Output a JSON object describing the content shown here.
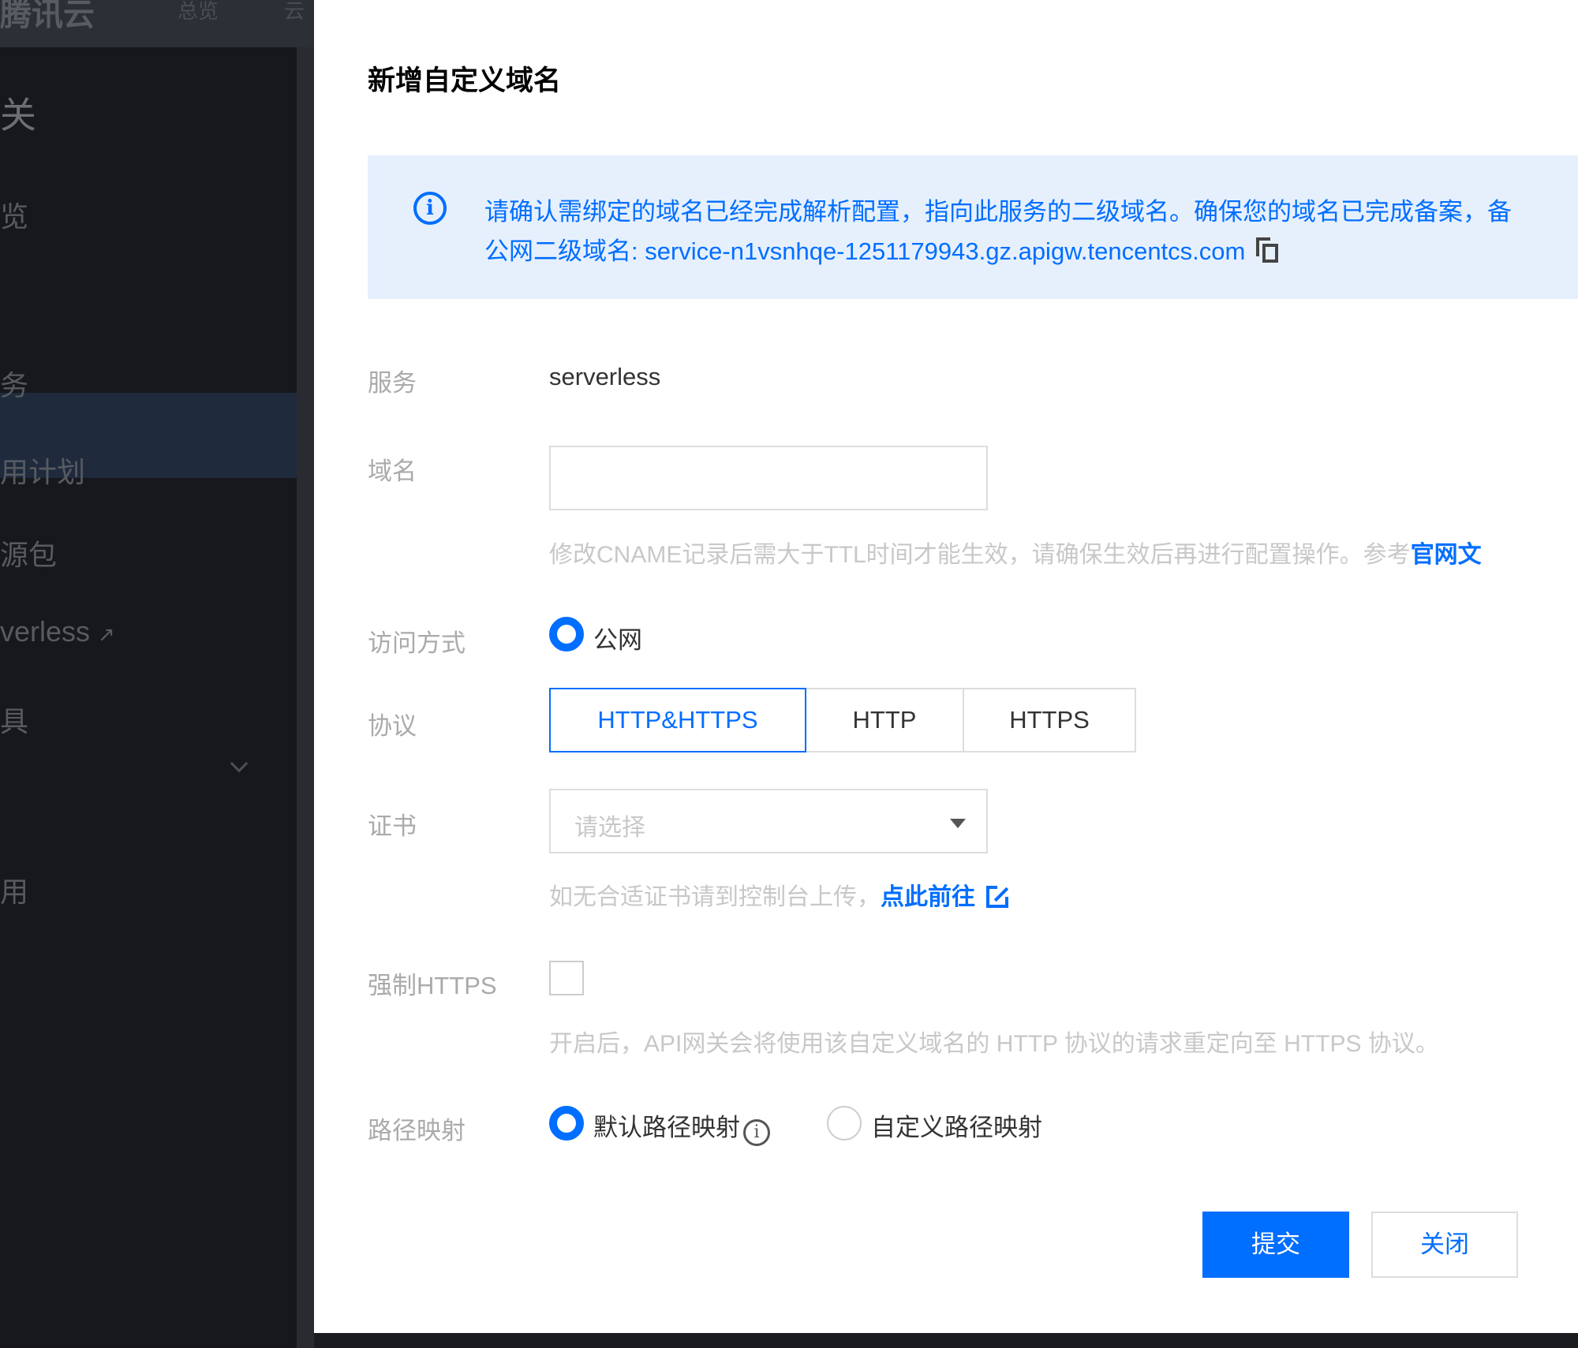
{
  "background": {
    "brand": "腾讯云",
    "nav": [
      "总览",
      "云"
    ],
    "section_title": "关",
    "items": [
      "览",
      "务",
      "用计划",
      "源包",
      "verless",
      "具",
      "用"
    ]
  },
  "modal": {
    "title": "新增自定义域名",
    "alert": {
      "line1": "请确认需绑定的域名已经完成解析配置，指向此服务的二级域名。确保您的域名已完成备案，备",
      "line2": "公网二级域名: service-n1vsnhqe-1251179943.gz.apigw.tencentcs.com"
    },
    "service": {
      "label": "服务",
      "value": "serverless"
    },
    "domain": {
      "label": "域名",
      "value": "",
      "hint": "修改CNAME记录后需大于TTL时间才能生效，请确保生效后再进行配置操作。参考",
      "hint_link": "官网文"
    },
    "access": {
      "label": "访问方式",
      "option": "公网"
    },
    "protocol": {
      "label": "协议",
      "options": [
        "HTTP&HTTPS",
        "HTTP",
        "HTTPS"
      ],
      "selected": "HTTP&HTTPS"
    },
    "certificate": {
      "label": "证书",
      "placeholder": "请选择",
      "hint": "如无合适证书请到控制台上传，",
      "hint_link": "点此前往"
    },
    "force_https": {
      "label": "强制HTTPS",
      "checked": false,
      "hint": "开启后，API网关会将使用该自定义域名的 HTTP 协议的请求重定向至 HTTPS 协议。"
    },
    "path_mapping": {
      "label": "路径映射",
      "default_option": "默认路径映射",
      "custom_option": "自定义路径映射",
      "selected": "默认路径映射"
    },
    "buttons": {
      "submit": "提交",
      "close": "关闭"
    }
  },
  "colors": {
    "accent": "#006eff",
    "alert_bg": "#e6f0fd",
    "label": "#aaaaaa",
    "sidebar_bg": "#17181c"
  }
}
